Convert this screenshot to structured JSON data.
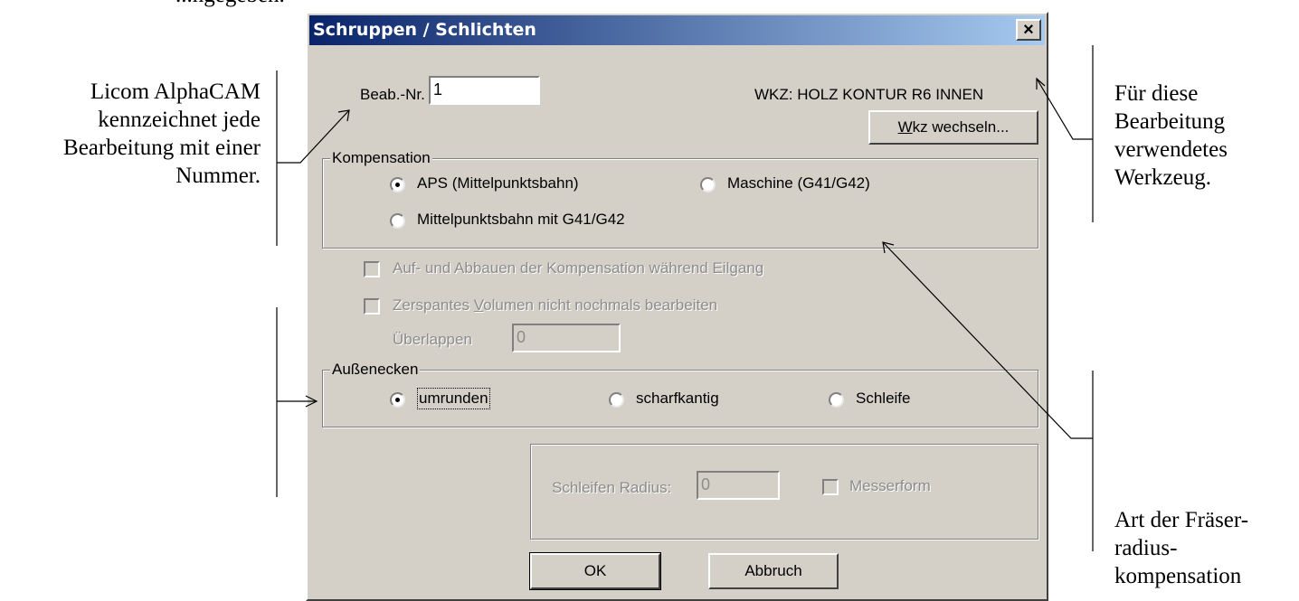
{
  "dialog": {
    "title": "Schruppen / Schlichten",
    "close_label": "×",
    "beab_label": "Beab.-Nr.",
    "beab_value": "1",
    "tool_label": "WKZ: HOLZ KONTUR R6 INNEN",
    "change_tool_label_pre": "",
    "change_tool_mnemonic": "W",
    "change_tool_label_post": "kz wechseln...",
    "compensation": {
      "legend": "Kompensation",
      "options": [
        "APS (Mittelpunktsbahn)",
        "Maschine (G41/G42)",
        "Mittelpunktsbahn mit G41/G42"
      ],
      "selected": "APS (Mittelpunktsbahn)"
    },
    "checkbox_rapid": "Auf- und Abbauen der Kompensation während Eilgang",
    "checkbox_volume_pre": "Zerspantes ",
    "checkbox_volume_mnemonic": "V",
    "checkbox_volume_post": "olumen nicht nochmals bearbeiten",
    "overlap_label": "Überlappen",
    "overlap_value": "0",
    "corners": {
      "legend": "Außenecken",
      "options": [
        "umrunden",
        "scharfkantig",
        "Schleife"
      ],
      "selected": "umrunden"
    },
    "loop_radius_label": "Schleifen Radius:",
    "loop_radius_value": "0",
    "knife_label": "Messerform",
    "ok_label": "OK",
    "cancel_label": "Abbruch"
  },
  "annotations": {
    "left_top": [
      "Licom AlphaCAM",
      "kennzeichnet jede",
      "Bearbeitung mit einer",
      "Nummer."
    ],
    "right_top": [
      "Für diese",
      "Bearbeitung",
      "verwendetes",
      "Werkzeug."
    ],
    "right_bottom": [
      "Art der Fräser-",
      "radius-",
      "kompensation"
    ],
    "top_fragment": "...ngegeben."
  }
}
